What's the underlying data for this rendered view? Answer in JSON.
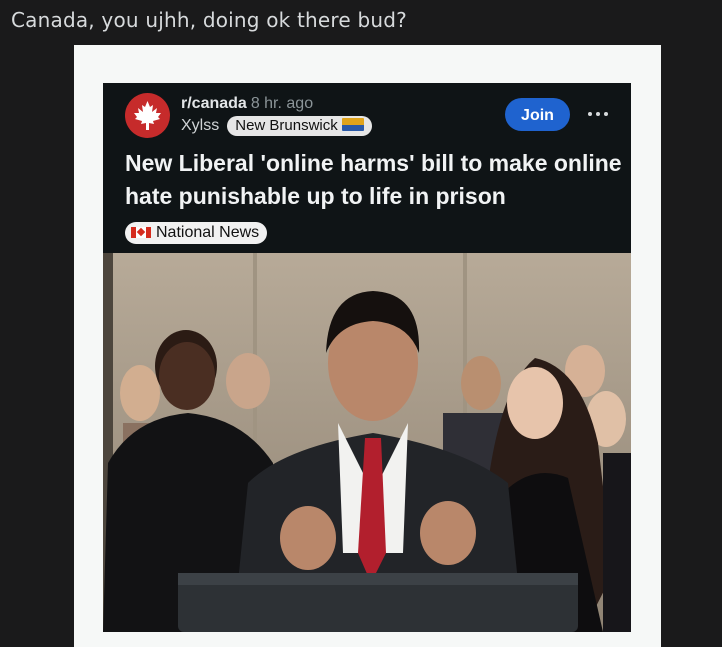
{
  "post": {
    "title": "Canada, you ujhh, doing ok there bud?"
  },
  "card": {
    "subreddit": "r/canada",
    "time": "8 hr. ago",
    "username": "Xylss",
    "user_flair": "New Brunswick",
    "join_label": "Join",
    "more_icon": "more-horizontal-icon",
    "headline": "New Liberal 'online harms' bill to make online hate punishable up to life in prison",
    "post_flair": "National News"
  },
  "colors": {
    "background": "#1a1a1b",
    "card": "#0f1416",
    "join": "#1f63cf",
    "avatar": "#c62b2b"
  }
}
